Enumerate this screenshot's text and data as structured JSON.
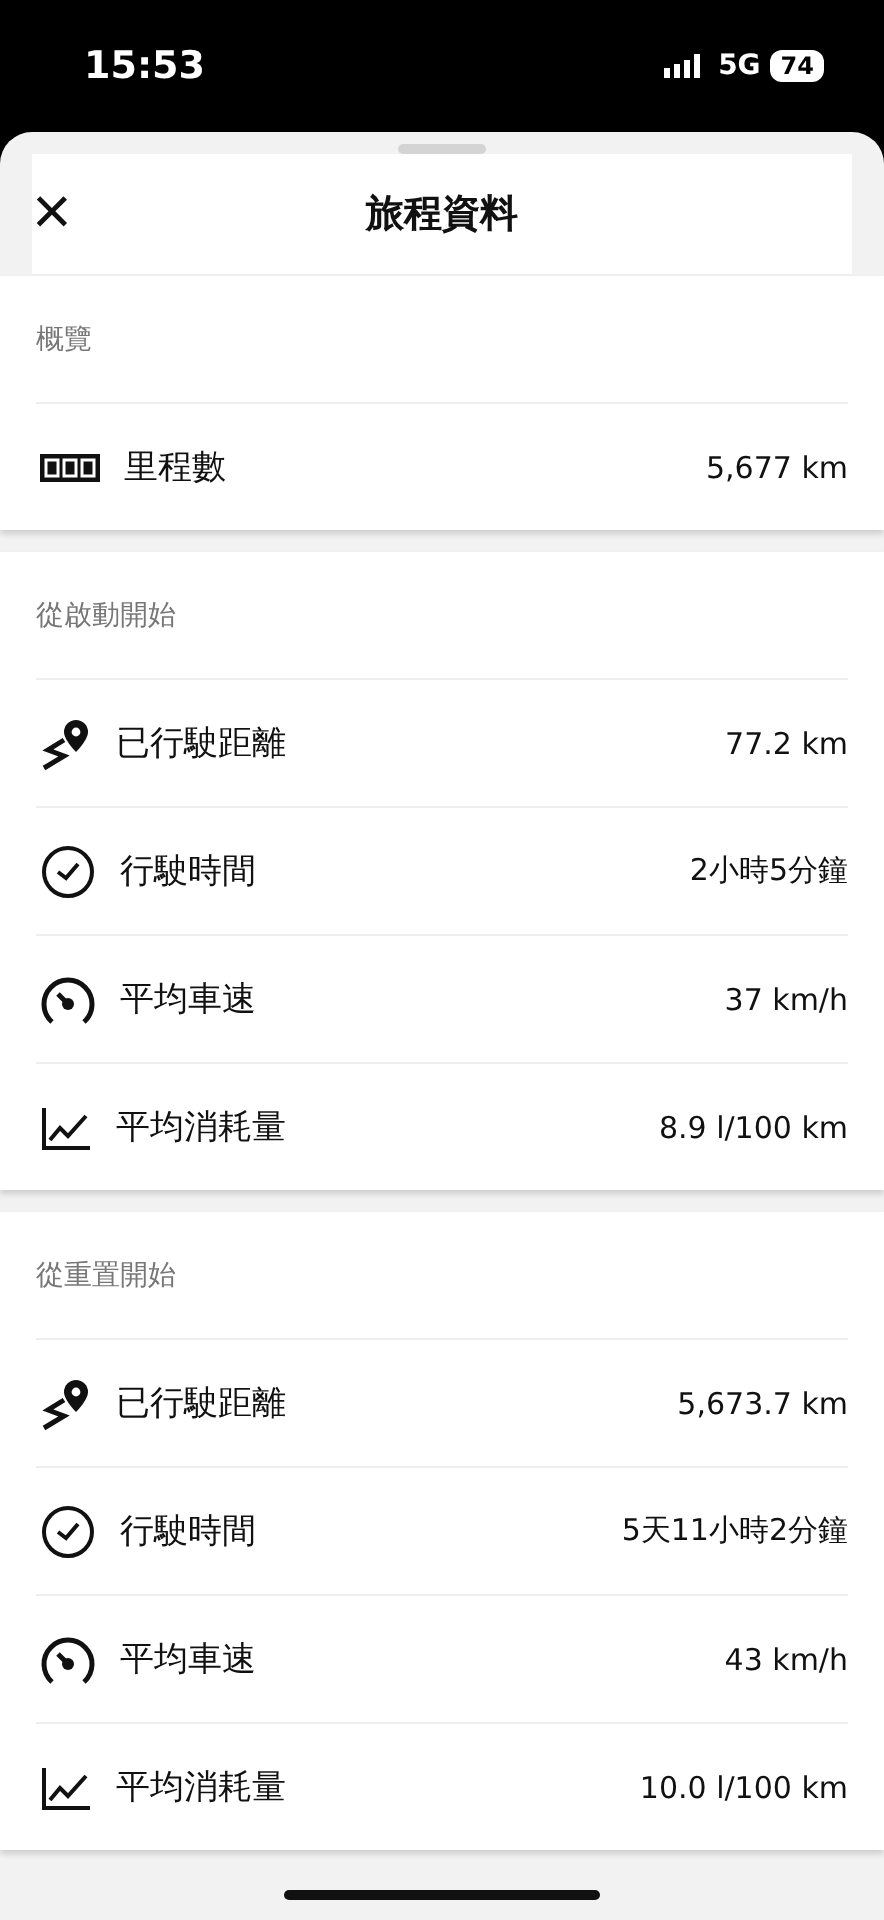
{
  "status_bar": {
    "time": "15:53",
    "network": "5G",
    "battery": "74"
  },
  "header": {
    "title": "旅程資料",
    "close": "×"
  },
  "sections": [
    {
      "title": "概覽",
      "rows": [
        {
          "kind": "odometer",
          "label": "里程數",
          "value": "5,677 km"
        }
      ]
    },
    {
      "title": "從啟動開始",
      "rows": [
        {
          "kind": "distance",
          "label": "已行駛距離",
          "value": "77.2 km"
        },
        {
          "kind": "time",
          "label": "行駛時間",
          "value": "2小時5分鐘"
        },
        {
          "kind": "speed",
          "label": "平均車速",
          "value": "37 km/h"
        },
        {
          "kind": "consumption",
          "label": "平均消耗量",
          "value": "8.9 l/100 km"
        }
      ]
    },
    {
      "title": "從重置開始",
      "rows": [
        {
          "kind": "distance",
          "label": "已行駛距離",
          "value": "5,673.7 km"
        },
        {
          "kind": "time",
          "label": "行駛時間",
          "value": "5天11小時2分鐘"
        },
        {
          "kind": "speed",
          "label": "平均車速",
          "value": "43 km/h"
        },
        {
          "kind": "consumption",
          "label": "平均消耗量",
          "value": "10.0 l/100 km"
        }
      ]
    }
  ]
}
